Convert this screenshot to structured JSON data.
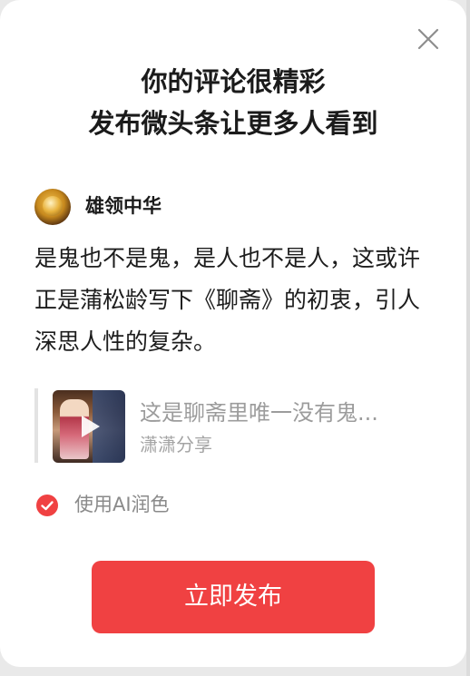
{
  "dialog": {
    "headline_line1": "你的评论很精彩",
    "headline_line2": "发布微头条让更多人看到",
    "close_icon": "close-icon"
  },
  "author": {
    "name": "雄领中华",
    "avatar_icon": "avatar-image"
  },
  "comment": {
    "text": "是鬼也不是鬼，是人也不是人，这或许正是蒲松龄写下《聊斋》的初衷，引人深思人性的复杂。"
  },
  "share_card": {
    "title": "这是聊斋里唯一没有鬼...",
    "source": "潇潇分享",
    "thumbnail_icon": "video-thumbnail",
    "play_icon": "play-icon"
  },
  "ai_polish": {
    "label": "使用AI润色",
    "checked": true,
    "check_color": "#f04142"
  },
  "actions": {
    "publish_label": "立即发布",
    "publish_color": "#f04142"
  }
}
